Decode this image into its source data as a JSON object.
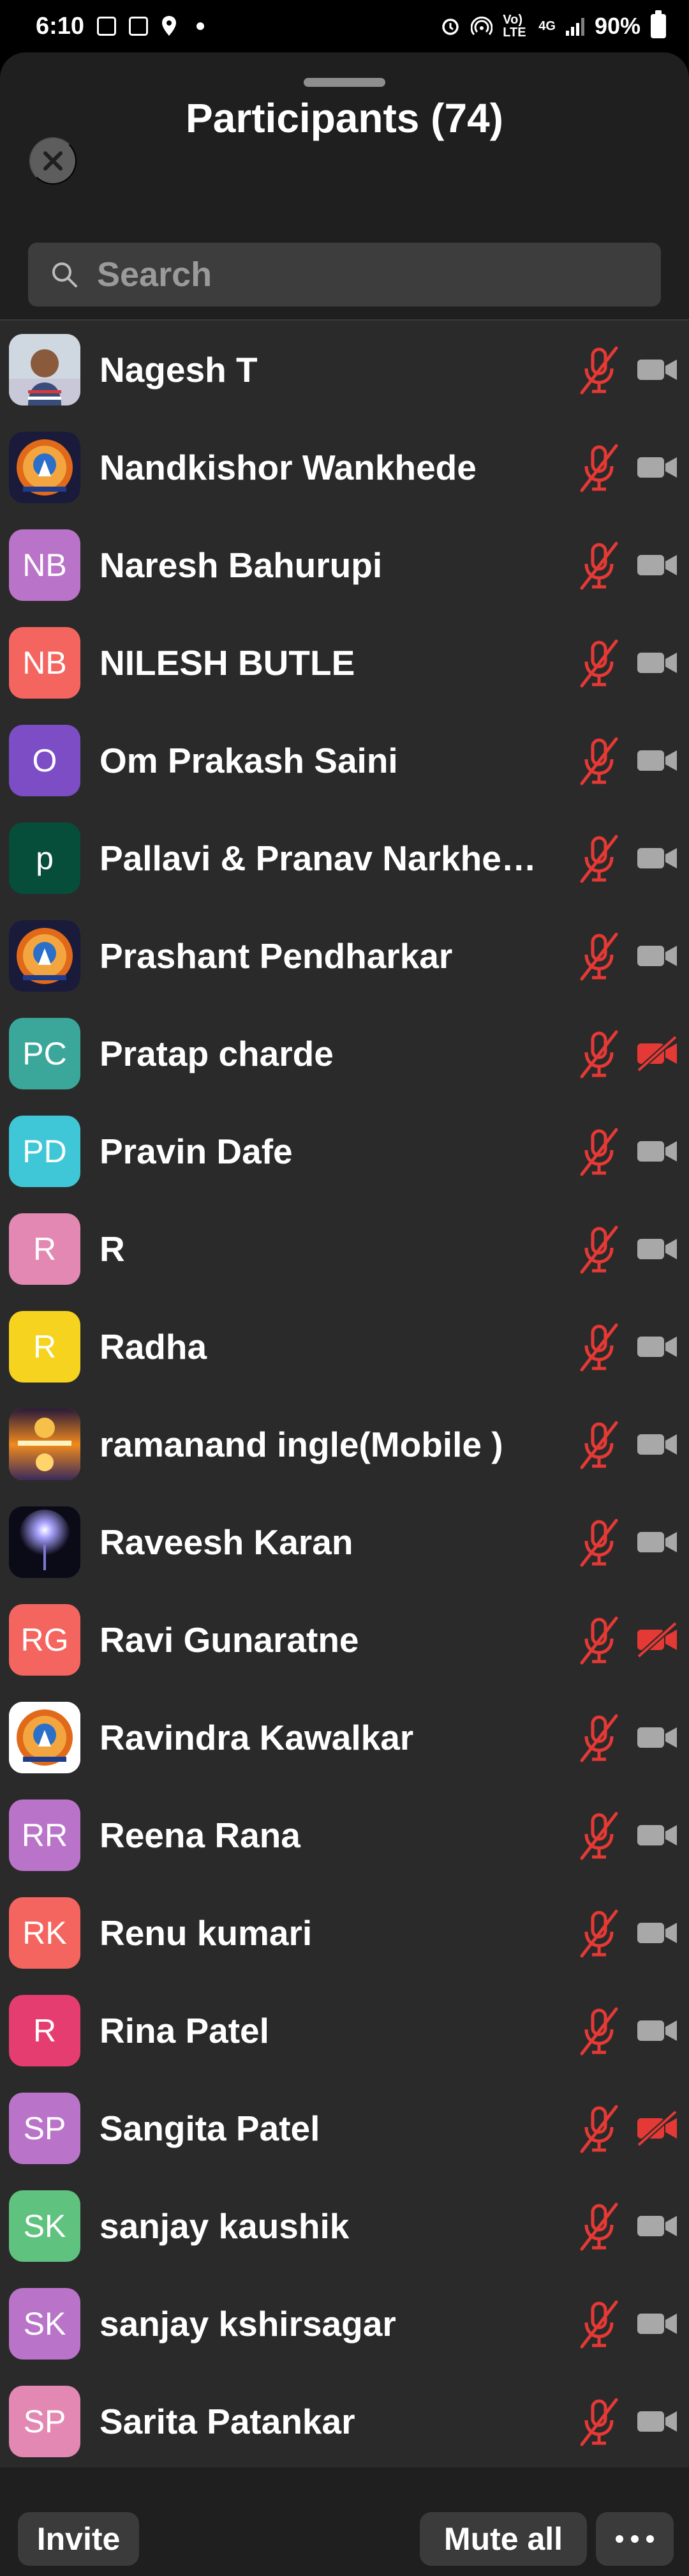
{
  "status_bar": {
    "time": "6:10",
    "network_label": "Vo) LTE",
    "network_type": "4G",
    "battery": "90%"
  },
  "header": {
    "title": "Participants (74)",
    "close_icon": "close-icon"
  },
  "search": {
    "placeholder": "Search",
    "value": ""
  },
  "colors": {
    "muted_red": "#e53935",
    "icon_gray": "#a8a8a8"
  },
  "participants": [
    {
      "name": "Nagesh T",
      "avatar_text": "",
      "avatar_kind": "photo-person",
      "avatar_color": "#7a8ba8",
      "mic": "muted",
      "video": "off-gray"
    },
    {
      "name": "Nandkishor Wankhede",
      "avatar_text": "",
      "avatar_kind": "photo-logo",
      "avatar_color": "#b45a1a",
      "mic": "muted",
      "video": "off-gray"
    },
    {
      "name": "Naresh Bahurupi",
      "avatar_text": "NB",
      "avatar_kind": "initials",
      "avatar_color": "#b974c9",
      "mic": "muted",
      "video": "off-gray"
    },
    {
      "name": "NILESH BUTLE",
      "avatar_text": "NB",
      "avatar_kind": "initials",
      "avatar_color": "#f4655f",
      "mic": "muted",
      "video": "off-gray"
    },
    {
      "name": "Om Prakash Saini",
      "avatar_text": "O",
      "avatar_kind": "initials",
      "avatar_color": "#7c4dc4",
      "mic": "muted",
      "video": "off-gray"
    },
    {
      "name": "Pallavi & Pranav Narkhe…",
      "avatar_text": "p",
      "avatar_kind": "initials",
      "avatar_color": "#064d3a",
      "mic": "muted",
      "video": "off-gray"
    },
    {
      "name": "Prashant Pendharkar",
      "avatar_text": "",
      "avatar_kind": "photo-logo",
      "avatar_color": "#b45a1a",
      "mic": "muted",
      "video": "off-gray"
    },
    {
      "name": "Pratap charde",
      "avatar_text": "PC",
      "avatar_kind": "initials",
      "avatar_color": "#3aa79a",
      "mic": "muted",
      "video": "off-red"
    },
    {
      "name": "Pravin Dafe",
      "avatar_text": "PD",
      "avatar_kind": "initials",
      "avatar_color": "#3fc7d8",
      "mic": "muted",
      "video": "off-gray"
    },
    {
      "name": "R",
      "avatar_text": "R",
      "avatar_kind": "initials",
      "avatar_color": "#e388b2",
      "mic": "muted",
      "video": "off-gray"
    },
    {
      "name": "Radha",
      "avatar_text": "R",
      "avatar_kind": "initials",
      "avatar_color": "#f5d31f",
      "mic": "muted",
      "video": "off-gray"
    },
    {
      "name": "ramanand ingle(Mobile )",
      "avatar_text": "",
      "avatar_kind": "photo-sunset",
      "avatar_color": "#f08a1e",
      "mic": "muted",
      "video": "off-gray"
    },
    {
      "name": "Raveesh Karan",
      "avatar_text": "",
      "avatar_kind": "photo-light",
      "avatar_color": "#151525",
      "mic": "muted",
      "video": "off-gray"
    },
    {
      "name": "Ravi Gunaratne",
      "avatar_text": "RG",
      "avatar_kind": "initials",
      "avatar_color": "#f4655f",
      "mic": "muted",
      "video": "off-red"
    },
    {
      "name": "Ravindra Kawalkar",
      "avatar_text": "",
      "avatar_kind": "photo-logo-white",
      "avatar_color": "#ffffff",
      "mic": "muted",
      "video": "off-gray"
    },
    {
      "name": "Reena Rana",
      "avatar_text": "RR",
      "avatar_kind": "initials",
      "avatar_color": "#b974c9",
      "mic": "muted",
      "video": "off-gray"
    },
    {
      "name": "Renu kumari",
      "avatar_text": "RK",
      "avatar_kind": "initials",
      "avatar_color": "#f4655f",
      "mic": "muted",
      "video": "off-gray"
    },
    {
      "name": "Rina Patel",
      "avatar_text": "R",
      "avatar_kind": "initials",
      "avatar_color": "#e63d71",
      "mic": "muted",
      "video": "off-gray"
    },
    {
      "name": "Sangita Patel",
      "avatar_text": "SP",
      "avatar_kind": "initials",
      "avatar_color": "#b974c9",
      "mic": "muted",
      "video": "off-red"
    },
    {
      "name": "sanjay kaushik",
      "avatar_text": "SK",
      "avatar_kind": "initials",
      "avatar_color": "#5fc27e",
      "mic": "muted",
      "video": "off-gray"
    },
    {
      "name": "sanjay kshirsagar",
      "avatar_text": "SK",
      "avatar_kind": "initials",
      "avatar_color": "#b974c9",
      "mic": "muted",
      "video": "off-gray"
    },
    {
      "name": "Sarita Patankar",
      "avatar_text": "SP",
      "avatar_kind": "initials",
      "avatar_color": "#e388b2",
      "mic": "muted",
      "video": "off-gray"
    }
  ],
  "footer": {
    "invite_label": "Invite",
    "mute_all_label": "Mute all",
    "more_icon": "more-icon"
  }
}
